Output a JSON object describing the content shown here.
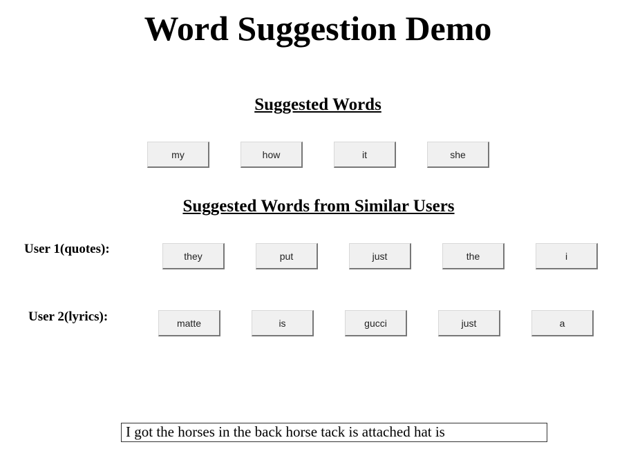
{
  "title": "Word Suggestion Demo",
  "suggested": {
    "heading": "Suggested Words",
    "words": [
      "my",
      "how",
      "it",
      "she"
    ]
  },
  "similar": {
    "heading": "Suggested Words from Similar Users",
    "users": [
      {
        "label": "User 1(quotes):",
        "words": [
          "they",
          "put",
          "just",
          "the",
          "i"
        ]
      },
      {
        "label": "User 2(lyrics):",
        "words": [
          "matte",
          "is",
          "gucci",
          "just",
          "a"
        ]
      }
    ]
  },
  "sentence": "I got the horses in the back horse tack is attached hat is"
}
